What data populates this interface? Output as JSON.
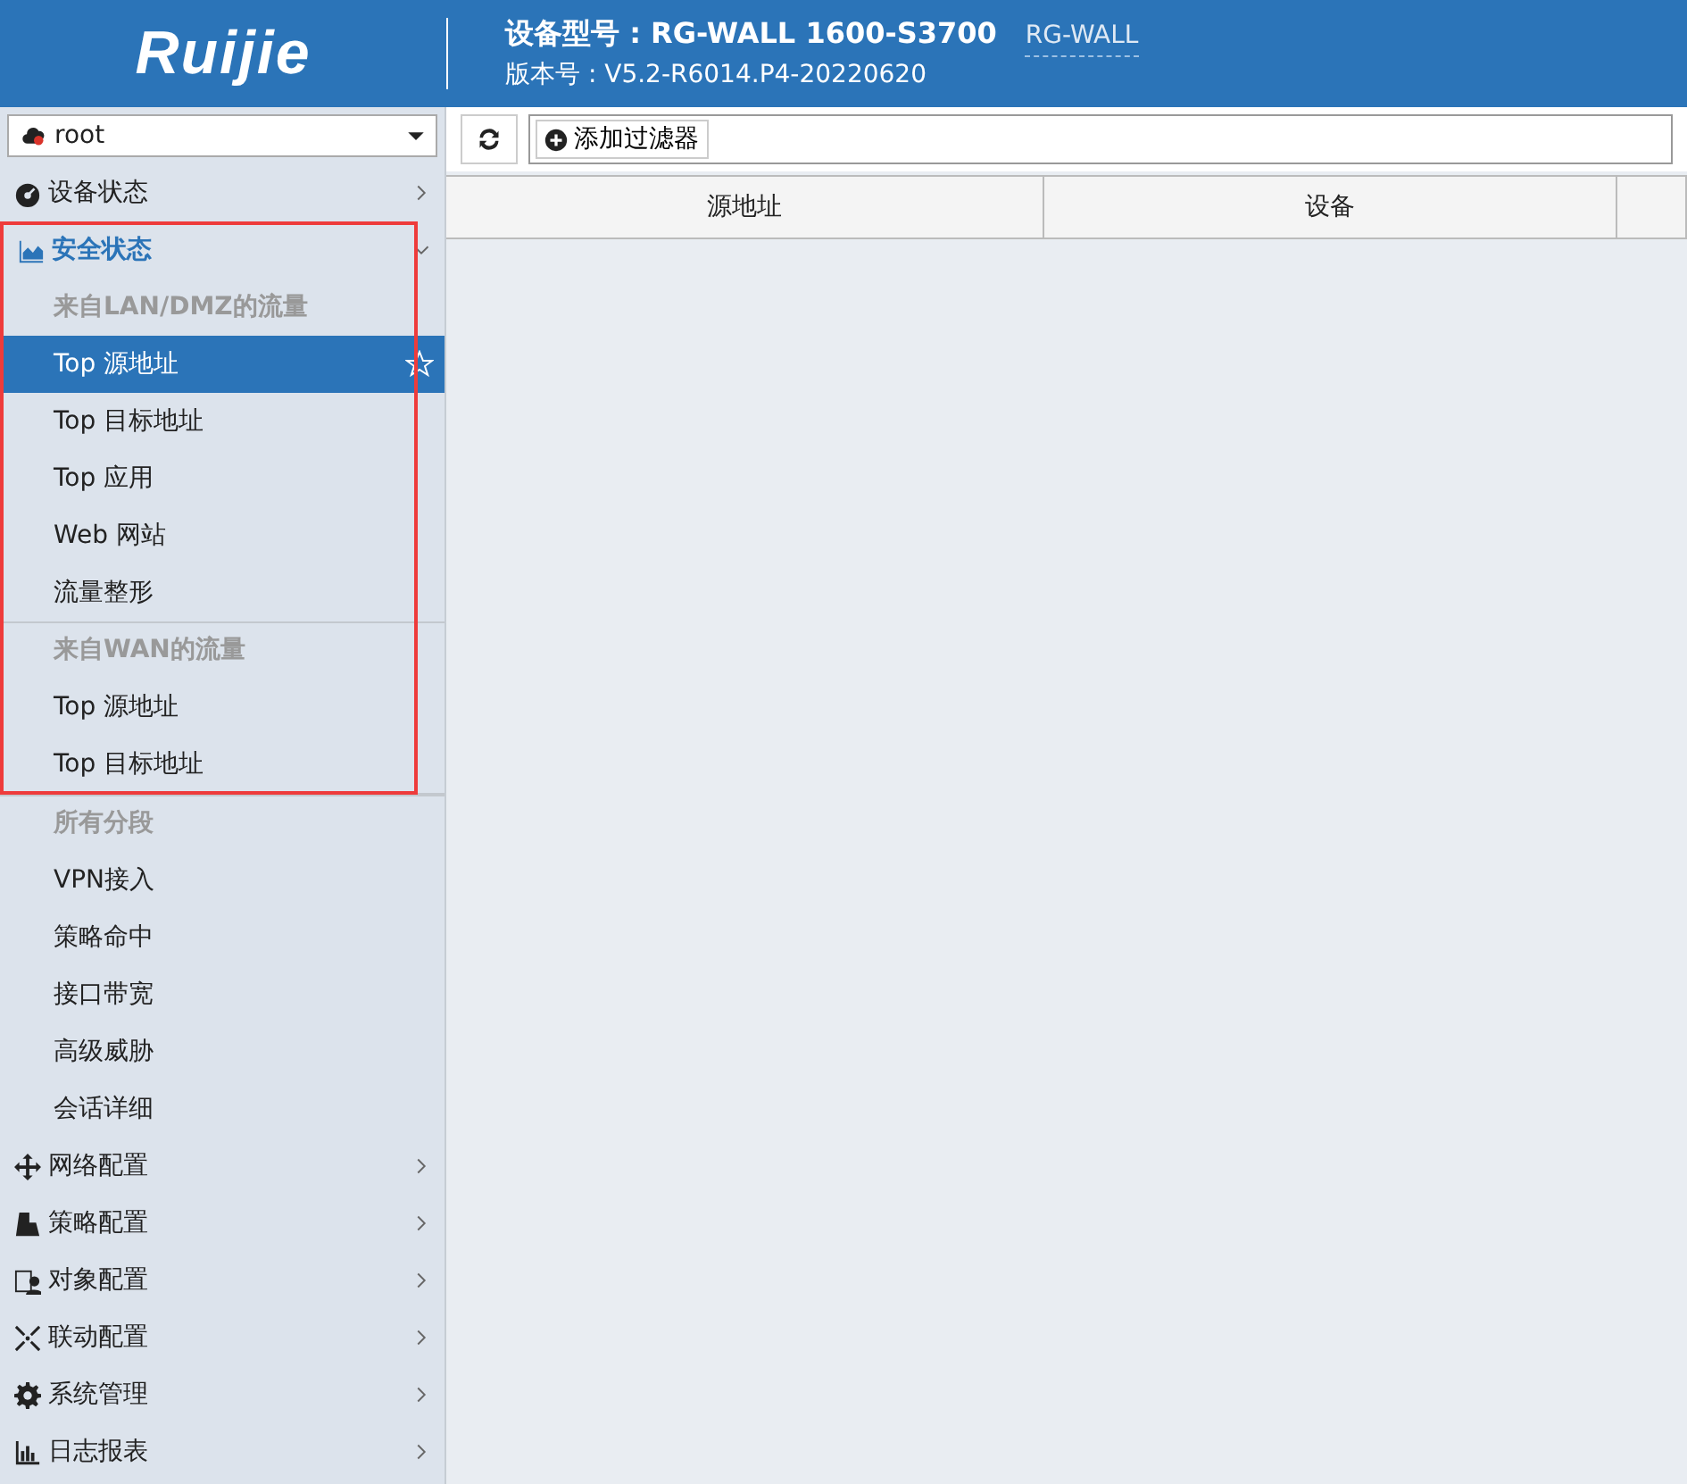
{
  "header": {
    "logo": "Ruijie",
    "device_model": "设备型号 : RG-WALL 1600-S3700",
    "model_link": "RG-WALL",
    "version": "版本号 : V5.2-R6014.P4-20220620"
  },
  "vsys_select": {
    "value": "root"
  },
  "menu": [
    {
      "label": "设备状态",
      "expanded": false
    },
    {
      "label": "安全状态",
      "expanded": true,
      "children": [
        {
          "heading": "来自LAN/DMZ的流量",
          "items": [
            {
              "label": "Top 源地址",
              "selected": true
            },
            {
              "label": "Top 目标地址",
              "selected": false
            },
            {
              "label": "Top 应用",
              "selected": false
            },
            {
              "label": "Web 网站",
              "selected": false
            },
            {
              "label": "流量整形",
              "selected": false
            }
          ]
        },
        {
          "heading": "来自WAN的流量",
          "items": [
            {
              "label": "Top 源地址",
              "selected": false
            },
            {
              "label": "Top 目标地址",
              "selected": false
            }
          ]
        },
        {
          "heading": "所有分段",
          "items": [
            {
              "label": "VPN接入",
              "selected": false
            },
            {
              "label": "策略命中",
              "selected": false
            },
            {
              "label": "接口带宽",
              "selected": false
            },
            {
              "label": "高级威胁",
              "selected": false
            },
            {
              "label": "会话详细",
              "selected": false
            }
          ]
        }
      ]
    },
    {
      "label": "网络配置",
      "expanded": false
    },
    {
      "label": "策略配置",
      "expanded": false
    },
    {
      "label": "对象配置",
      "expanded": false
    },
    {
      "label": "联动配置",
      "expanded": false
    },
    {
      "label": "系统管理",
      "expanded": false
    },
    {
      "label": "日志报表",
      "expanded": false
    }
  ],
  "annotation": {
    "kind": "rectangle",
    "color": "#ee3b3b"
  },
  "toolbar": {
    "add_filter": "添加过滤器"
  },
  "table": {
    "columns": [
      "源地址",
      "设备"
    ]
  }
}
